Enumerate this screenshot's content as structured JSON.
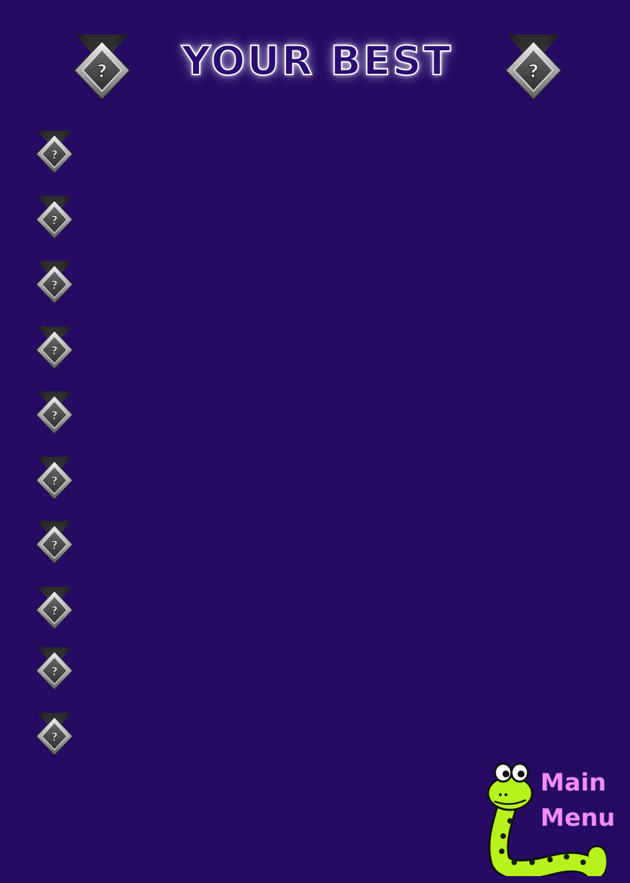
{
  "title": "YOUR BEST",
  "colors": {
    "background": "#250b64",
    "title_fill": "#2a0f72",
    "title_outline": "#ffffff",
    "menu_text": "#f28cf4",
    "snake_green": "#b7f21c"
  },
  "header_icons": [
    "locked-medal-icon",
    "locked-medal-icon"
  ],
  "achievements": [
    {
      "icon": "locked-medal-icon",
      "label": ""
    },
    {
      "icon": "locked-medal-icon",
      "label": ""
    },
    {
      "icon": "locked-medal-icon",
      "label": ""
    },
    {
      "icon": "locked-medal-icon",
      "label": ""
    },
    {
      "icon": "locked-medal-icon",
      "label": ""
    },
    {
      "icon": "locked-medal-icon",
      "label": ""
    },
    {
      "icon": "locked-medal-icon",
      "label": ""
    },
    {
      "icon": "locked-medal-icon",
      "label": ""
    },
    {
      "icon": "locked-medal-icon",
      "label": ""
    },
    {
      "icon": "locked-medal-icon",
      "label": ""
    }
  ],
  "main_menu": {
    "line1": "Main",
    "line2": "Menu",
    "icon": "snake-mascot-icon"
  }
}
